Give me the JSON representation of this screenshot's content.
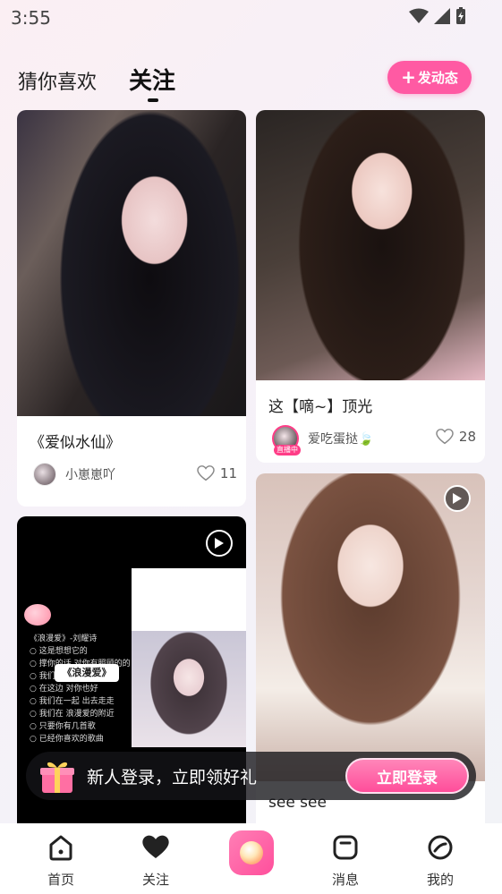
{
  "status_bar": {
    "time": "3:55"
  },
  "header": {
    "tabs": [
      {
        "label": "猜你喜欢",
        "active": false
      },
      {
        "label": "关注",
        "active": true
      }
    ],
    "post_button": {
      "label": "发动态",
      "icon": "plus-icon"
    }
  },
  "feed": {
    "cards": [
      {
        "title": "《爱似水仙》",
        "author": "小崽崽吖",
        "likes": "11",
        "live": false,
        "video": false
      },
      {
        "title": "这【嘀~】顶光",
        "author": "爱吃蛋挞🍃",
        "likes": "28",
        "live": true,
        "live_tag": "直播中",
        "video": false
      },
      {
        "title": "",
        "author": "",
        "likes": "",
        "video": true,
        "sticker_text": "《浪漫爱》",
        "lyrics": [
          "《浪漫爱》-刘耀诗",
          "○ 这是想想它的",
          "○ 撑你的话 对你有照顾的的",
          "○ 我们的用户",
          "○ 在这边 对你也好",
          "○ 我们在一起 出去走走",
          "○ 我们在 浪漫爱的附近",
          "○ 只要你有几首歌",
          "○ 已经你喜欢的歌曲"
        ]
      },
      {
        "title": "see see",
        "author": "",
        "likes": "",
        "video": true
      }
    ]
  },
  "login_banner": {
    "text": "新人登录，立即领好礼",
    "button": "立即登录",
    "icon": "gift-icon"
  },
  "bottom_nav": {
    "items": [
      {
        "label": "首页",
        "icon": "home-icon"
      },
      {
        "label": "关注",
        "icon": "heart-icon"
      },
      {
        "label": "",
        "icon": "camera-center-icon"
      },
      {
        "label": "消息",
        "icon": "message-icon"
      },
      {
        "label": "我的",
        "icon": "profile-icon"
      }
    ]
  },
  "colors": {
    "accent": "#ff5aa3",
    "live": "#ff3d87"
  }
}
